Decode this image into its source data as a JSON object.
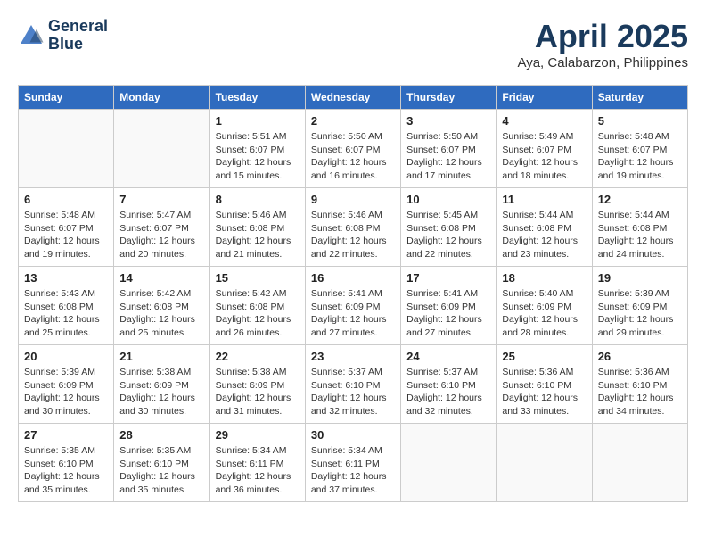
{
  "header": {
    "logo_line1": "General",
    "logo_line2": "Blue",
    "month_title": "April 2025",
    "location": "Aya, Calabarzon, Philippines"
  },
  "weekdays": [
    "Sunday",
    "Monday",
    "Tuesday",
    "Wednesday",
    "Thursday",
    "Friday",
    "Saturday"
  ],
  "weeks": [
    [
      {
        "day": "",
        "info": ""
      },
      {
        "day": "",
        "info": ""
      },
      {
        "day": "1",
        "info": "Sunrise: 5:51 AM\nSunset: 6:07 PM\nDaylight: 12 hours\nand 15 minutes."
      },
      {
        "day": "2",
        "info": "Sunrise: 5:50 AM\nSunset: 6:07 PM\nDaylight: 12 hours\nand 16 minutes."
      },
      {
        "day": "3",
        "info": "Sunrise: 5:50 AM\nSunset: 6:07 PM\nDaylight: 12 hours\nand 17 minutes."
      },
      {
        "day": "4",
        "info": "Sunrise: 5:49 AM\nSunset: 6:07 PM\nDaylight: 12 hours\nand 18 minutes."
      },
      {
        "day": "5",
        "info": "Sunrise: 5:48 AM\nSunset: 6:07 PM\nDaylight: 12 hours\nand 19 minutes."
      }
    ],
    [
      {
        "day": "6",
        "info": "Sunrise: 5:48 AM\nSunset: 6:07 PM\nDaylight: 12 hours\nand 19 minutes."
      },
      {
        "day": "7",
        "info": "Sunrise: 5:47 AM\nSunset: 6:07 PM\nDaylight: 12 hours\nand 20 minutes."
      },
      {
        "day": "8",
        "info": "Sunrise: 5:46 AM\nSunset: 6:08 PM\nDaylight: 12 hours\nand 21 minutes."
      },
      {
        "day": "9",
        "info": "Sunrise: 5:46 AM\nSunset: 6:08 PM\nDaylight: 12 hours\nand 22 minutes."
      },
      {
        "day": "10",
        "info": "Sunrise: 5:45 AM\nSunset: 6:08 PM\nDaylight: 12 hours\nand 22 minutes."
      },
      {
        "day": "11",
        "info": "Sunrise: 5:44 AM\nSunset: 6:08 PM\nDaylight: 12 hours\nand 23 minutes."
      },
      {
        "day": "12",
        "info": "Sunrise: 5:44 AM\nSunset: 6:08 PM\nDaylight: 12 hours\nand 24 minutes."
      }
    ],
    [
      {
        "day": "13",
        "info": "Sunrise: 5:43 AM\nSunset: 6:08 PM\nDaylight: 12 hours\nand 25 minutes."
      },
      {
        "day": "14",
        "info": "Sunrise: 5:42 AM\nSunset: 6:08 PM\nDaylight: 12 hours\nand 25 minutes."
      },
      {
        "day": "15",
        "info": "Sunrise: 5:42 AM\nSunset: 6:08 PM\nDaylight: 12 hours\nand 26 minutes."
      },
      {
        "day": "16",
        "info": "Sunrise: 5:41 AM\nSunset: 6:09 PM\nDaylight: 12 hours\nand 27 minutes."
      },
      {
        "day": "17",
        "info": "Sunrise: 5:41 AM\nSunset: 6:09 PM\nDaylight: 12 hours\nand 27 minutes."
      },
      {
        "day": "18",
        "info": "Sunrise: 5:40 AM\nSunset: 6:09 PM\nDaylight: 12 hours\nand 28 minutes."
      },
      {
        "day": "19",
        "info": "Sunrise: 5:39 AM\nSunset: 6:09 PM\nDaylight: 12 hours\nand 29 minutes."
      }
    ],
    [
      {
        "day": "20",
        "info": "Sunrise: 5:39 AM\nSunset: 6:09 PM\nDaylight: 12 hours\nand 30 minutes."
      },
      {
        "day": "21",
        "info": "Sunrise: 5:38 AM\nSunset: 6:09 PM\nDaylight: 12 hours\nand 30 minutes."
      },
      {
        "day": "22",
        "info": "Sunrise: 5:38 AM\nSunset: 6:09 PM\nDaylight: 12 hours\nand 31 minutes."
      },
      {
        "day": "23",
        "info": "Sunrise: 5:37 AM\nSunset: 6:10 PM\nDaylight: 12 hours\nand 32 minutes."
      },
      {
        "day": "24",
        "info": "Sunrise: 5:37 AM\nSunset: 6:10 PM\nDaylight: 12 hours\nand 32 minutes."
      },
      {
        "day": "25",
        "info": "Sunrise: 5:36 AM\nSunset: 6:10 PM\nDaylight: 12 hours\nand 33 minutes."
      },
      {
        "day": "26",
        "info": "Sunrise: 5:36 AM\nSunset: 6:10 PM\nDaylight: 12 hours\nand 34 minutes."
      }
    ],
    [
      {
        "day": "27",
        "info": "Sunrise: 5:35 AM\nSunset: 6:10 PM\nDaylight: 12 hours\nand 35 minutes."
      },
      {
        "day": "28",
        "info": "Sunrise: 5:35 AM\nSunset: 6:10 PM\nDaylight: 12 hours\nand 35 minutes."
      },
      {
        "day": "29",
        "info": "Sunrise: 5:34 AM\nSunset: 6:11 PM\nDaylight: 12 hours\nand 36 minutes."
      },
      {
        "day": "30",
        "info": "Sunrise: 5:34 AM\nSunset: 6:11 PM\nDaylight: 12 hours\nand 37 minutes."
      },
      {
        "day": "",
        "info": ""
      },
      {
        "day": "",
        "info": ""
      },
      {
        "day": "",
        "info": ""
      }
    ]
  ]
}
